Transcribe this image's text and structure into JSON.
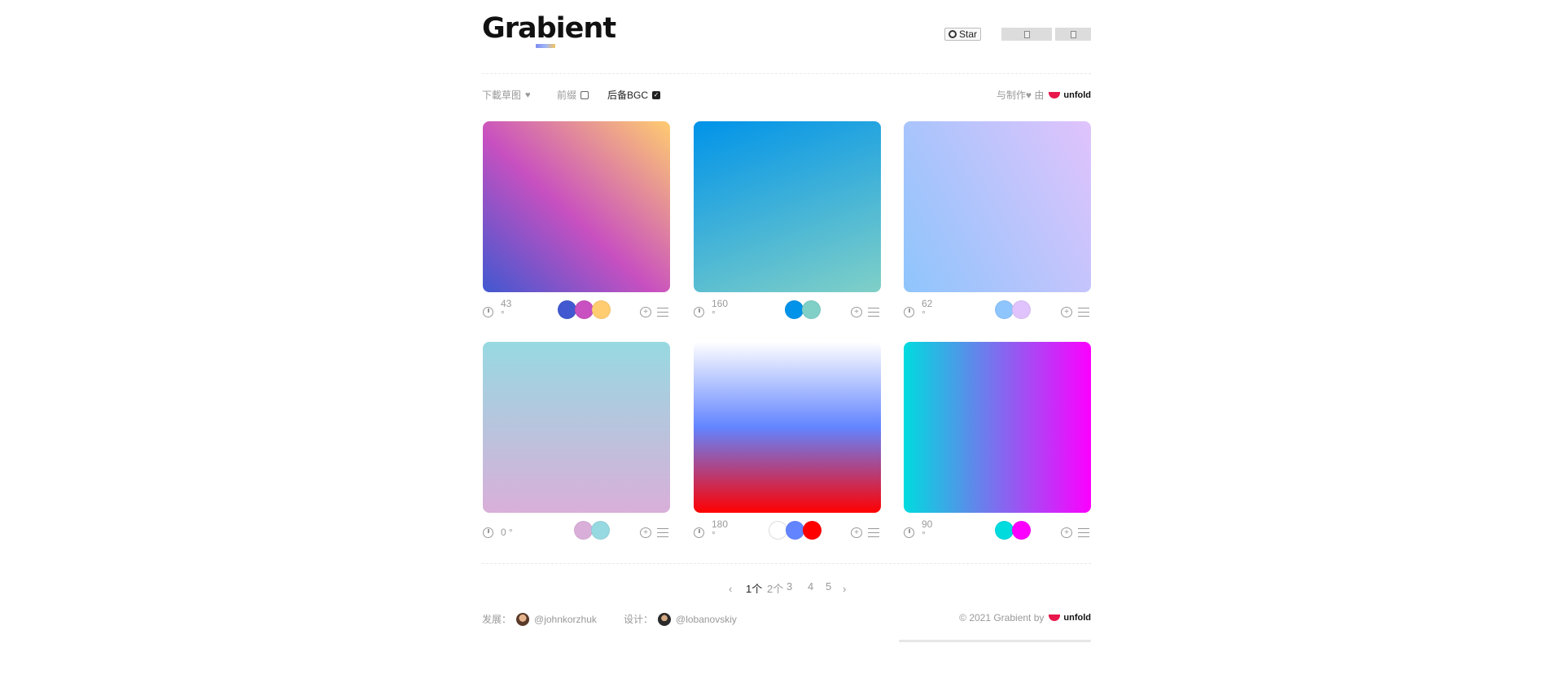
{
  "header": {
    "logo": "Grabient",
    "star_label": "Star"
  },
  "options": {
    "download": "下載草图",
    "prefix": "前缀",
    "fallback": "后备BGC",
    "made_with": "与制作♥ 由",
    "brand": "unfold"
  },
  "cards": [
    {
      "angle": "43",
      "unit": "°",
      "colors": [
        "#4158D0",
        "#C850C0",
        "#FFCC70"
      ]
    },
    {
      "angle": "160",
      "unit": "°",
      "colors": [
        "#0093E9",
        "#80D0C7"
      ]
    },
    {
      "angle": "62",
      "unit": "°",
      "colors": [
        "#8EC5FC",
        "#E0C3FC"
      ]
    },
    {
      "angle": "0 °",
      "unit": "",
      "colors": [
        "#D9AFD9",
        "#97D9E1"
      ]
    },
    {
      "angle": "180",
      "unit": "°",
      "colors": [
        "#FFFFFF",
        "#6284FF",
        "#FF0000"
      ]
    },
    {
      "angle": "90",
      "unit": "°",
      "colors": [
        "#00DBDE",
        "#FC00FF"
      ]
    }
  ],
  "pagination": {
    "prev": "‹",
    "pages": [
      "1个",
      "2个",
      "3",
      "4",
      "5"
    ],
    "next": "›"
  },
  "footer": {
    "dev_label": "发展：",
    "dev_handle": "@johnkorzhuk",
    "design_label": "设计：",
    "design_handle": "@lobanovskiy",
    "copyright": "© 2021 Grabient by",
    "brand": "unfold"
  }
}
